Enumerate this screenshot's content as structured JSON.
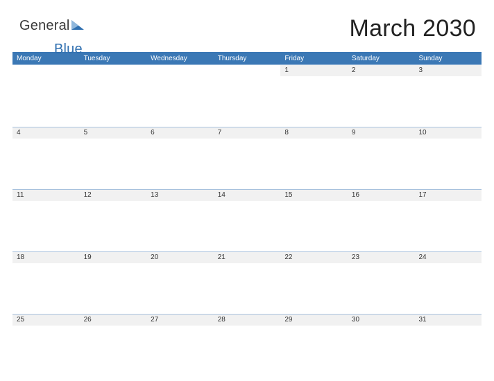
{
  "brand": {
    "word1": "General",
    "word2": "Blue"
  },
  "title": "March 2030",
  "dow": [
    "Monday",
    "Tuesday",
    "Wednesday",
    "Thursday",
    "Friday",
    "Saturday",
    "Sunday"
  ],
  "weeks": [
    [
      "",
      "",
      "",
      "",
      "1",
      "2",
      "3"
    ],
    [
      "4",
      "5",
      "6",
      "7",
      "8",
      "9",
      "10"
    ],
    [
      "11",
      "12",
      "13",
      "14",
      "15",
      "16",
      "17"
    ],
    [
      "18",
      "19",
      "20",
      "21",
      "22",
      "23",
      "24"
    ],
    [
      "25",
      "26",
      "27",
      "28",
      "29",
      "30",
      "31"
    ]
  ],
  "colors": {
    "header_bar": "#3b78b5",
    "rule": "#a7c1dd",
    "band": "#f1f1f1"
  }
}
